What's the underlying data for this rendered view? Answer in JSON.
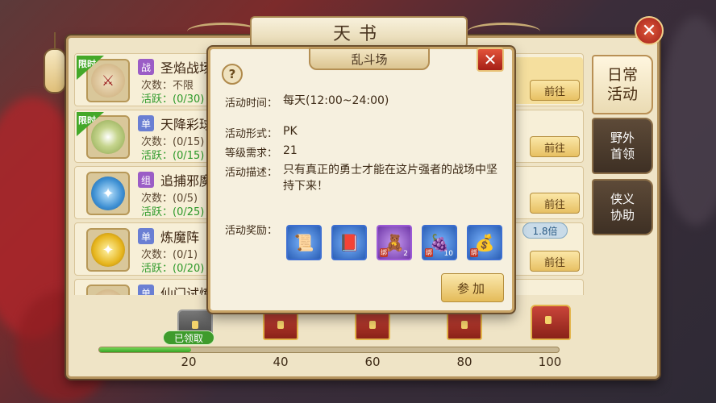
{
  "window": {
    "title": "天书"
  },
  "tabs": [
    {
      "label": "日常活动",
      "active": true
    },
    {
      "label": "野外首领",
      "active": false
    },
    {
      "label": "侠义协助",
      "active": false
    }
  ],
  "activities": [
    {
      "name": "圣焰战场",
      "tag": "战",
      "badge": "限时",
      "count": "次数：不限",
      "active": "活跃：(0/30)",
      "button": "前往"
    },
    {
      "name": "天降彩球",
      "tag": "单",
      "badge": "限时",
      "count": "次数：(0/15)",
      "active": "活跃：(0/15)",
      "button": "前往"
    },
    {
      "name": "追捕邪魔",
      "tag": "组",
      "badge": "",
      "count": "次数：(0/5)",
      "active": "活跃：(0/25)",
      "button": "前往"
    },
    {
      "name": "炼魔阵",
      "tag": "单",
      "badge": "",
      "count": "次数：(0/1)",
      "active": "活跃：(0/20)",
      "button": "前往"
    },
    {
      "name": "仙门试炼",
      "tag": "单",
      "badge": "",
      "count": "",
      "active": "",
      "button": ""
    }
  ],
  "multiplier": "1.8倍",
  "progress": {
    "claimed_label": "已领取",
    "milestones": [
      "20",
      "40",
      "60",
      "80",
      "100"
    ],
    "current_fraction": 0.2
  },
  "popup": {
    "title": "乱斗场",
    "help": "?",
    "close": "✕",
    "time_label": "活动时间：",
    "time_value": "每天(12:00~24:00)",
    "form_label": "活动形式：",
    "form_value": "PK",
    "level_label": "等级需求：",
    "level_value": "21",
    "desc_label": "活动描述：",
    "desc_value": "只有真正的勇士才能在这片强者的战场中坚持下来！",
    "reward_label": "活动奖励：",
    "rewards": [
      {
        "icon": "scroll-icon",
        "bind": "",
        "qty": ""
      },
      {
        "icon": "book-icon",
        "bind": "",
        "qty": ""
      },
      {
        "icon": "doll-icon",
        "bind": "绑",
        "qty": "2"
      },
      {
        "icon": "grape-icon",
        "bind": "绑",
        "qty": "10"
      },
      {
        "icon": "pouch-icon",
        "bind": "绑",
        "qty": ""
      }
    ],
    "join_button": "参加"
  },
  "close_button": "✕"
}
